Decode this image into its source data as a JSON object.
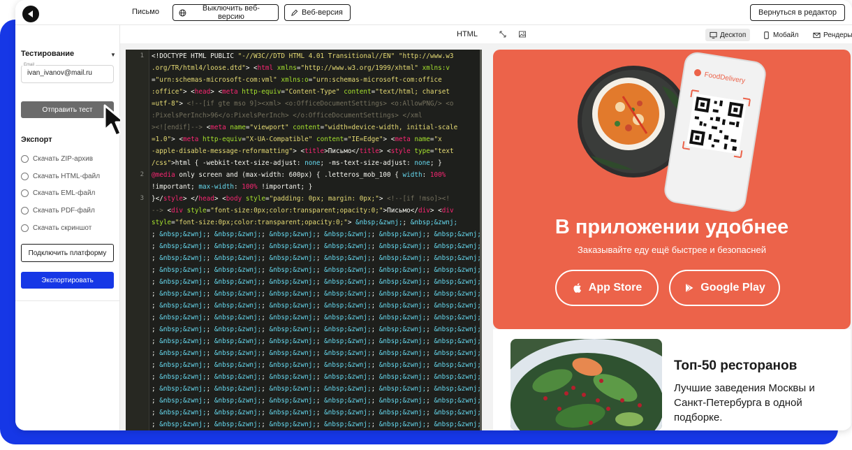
{
  "topbar": {
    "letter_label": "Письмо",
    "disable_web_label": "Выключить веб-версию",
    "web_version_label": "Веб-версия",
    "back_to_editor_label": "Вернуться в редактор"
  },
  "toolbar": {
    "format_label": "HTML",
    "views": {
      "desktop": "Десктоп",
      "mobile": "Мобайл",
      "renders": "Рендеры"
    }
  },
  "sidebar": {
    "testing_title": "Тестирование",
    "email_label": "Email",
    "email_value": "ivan_ivanov@mail.ru",
    "send_test_label": "Отправить тест",
    "export_title": "Экспорт",
    "export_options": [
      "Скачать ZIP-архив",
      "Скачать HTML-файл",
      "Скачать EML-файл",
      "Скачать PDF-файл",
      "Скачать скриншот"
    ],
    "connect_platform_label": "Подключить платформу",
    "export_button_label": "Экспортировать"
  },
  "editor": {
    "line_numbers": [
      "1",
      "2",
      "3"
    ]
  },
  "preview": {
    "phone_brand": "FoodDelivery",
    "promo_title": "В приложении удобнее",
    "promo_subtitle": "Заказывайте еду ещё быстрее и безопасней",
    "app_store_label": "App Store",
    "google_play_label": "Google Play",
    "card_title": "Топ-50 ресторанов",
    "card_text": "Лучшие заведения Москвы и Санкт-Петербурга в одной подборке."
  },
  "colors": {
    "accent_blue": "#1637e6",
    "promo_orange": "#ec634a",
    "editor_bg": "#1e1f1c"
  }
}
